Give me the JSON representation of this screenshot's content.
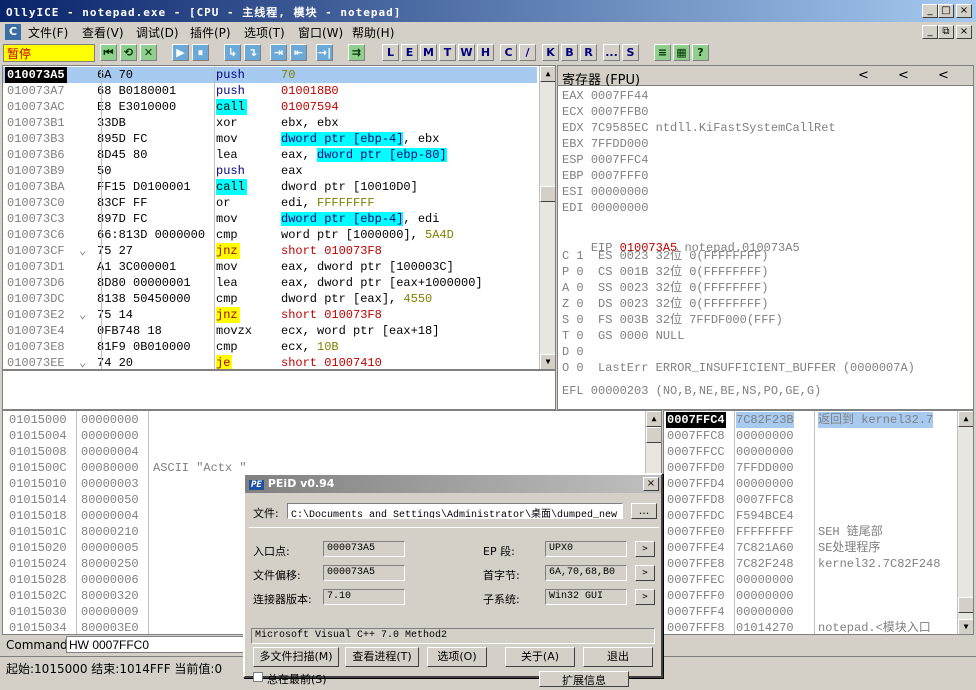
{
  "window": {
    "title": "OllyICE - notepad.exe - [CPU -  主线程, 模块 - notepad]",
    "min": "_",
    "max": "□",
    "close": "×",
    "inner_min": "_",
    "inner_restore": "⧉",
    "inner_close": "×"
  },
  "menu": {
    "icon": "C",
    "items": [
      "文件(F)",
      "查看(V)",
      "调试(D)",
      "插件(P)",
      "选项(T)",
      "窗口(W)",
      "帮助(H)"
    ]
  },
  "toolbar": {
    "status": "暂停",
    "buttons_a": [
      "⏮",
      "⟲",
      "✕",
      "▶",
      "⏸",
      "↳",
      "↴",
      "⇥",
      "⇤",
      "→|",
      "⇉"
    ],
    "letters": [
      "L",
      "E",
      "M",
      "T",
      "W",
      "H",
      "C",
      "/",
      "K",
      "B",
      "R",
      "...",
      "S"
    ],
    "icons_b": [
      "≡",
      "▦",
      "?"
    ]
  },
  "disasm": {
    "rows": [
      {
        "addr": "010073A5",
        "mark": "",
        "hex": "6A 70",
        "mnem": "push",
        "ops": [
          {
            "t": "70",
            "c": "olive"
          }
        ]
      },
      {
        "addr": "010073A7",
        "mark": "",
        "hex": "68 B0180001",
        "mnem": "push",
        "ops": [
          {
            "t": "010018B0",
            "c": "red"
          }
        ]
      },
      {
        "addr": "010073AC",
        "mark": "",
        "hex": "E8 E3010000",
        "mnem": "call",
        "mhl": "call",
        "ops": [
          {
            "t": "01007594",
            "c": "red"
          }
        ]
      },
      {
        "addr": "010073B1",
        "mark": "",
        "hex": "33DB",
        "mnem": "xor",
        "ops": [
          {
            "t": "ebx, ebx",
            "c": ""
          }
        ]
      },
      {
        "addr": "010073B3",
        "mark": "",
        "hex": "895D FC",
        "mnem": "mov",
        "ops": [
          {
            "t": "dword ptr [ebp-4]",
            "c": "mem"
          },
          {
            "t": ", ebx",
            "c": ""
          }
        ]
      },
      {
        "addr": "010073B6",
        "mark": "",
        "hex": "8D45 80",
        "mnem": "lea",
        "ops": [
          {
            "t": "eax, ",
            "c": ""
          },
          {
            "t": "dword ptr [ebp-80]",
            "c": "mem"
          }
        ]
      },
      {
        "addr": "010073B9",
        "mark": "",
        "hex": "50",
        "mnem": "push",
        "ops": [
          {
            "t": "eax",
            "c": ""
          }
        ]
      },
      {
        "addr": "010073BA",
        "mark": "",
        "hex": "FF15 D0100001",
        "mnem": "call",
        "mhl": "call",
        "ops": [
          {
            "t": "dword ptr [10010D0]",
            "c": ""
          }
        ]
      },
      {
        "addr": "010073C0",
        "mark": "",
        "hex": "83CF FF",
        "mnem": "or",
        "ops": [
          {
            "t": "edi, ",
            "c": ""
          },
          {
            "t": "FFFFFFFF",
            "c": "olive"
          }
        ]
      },
      {
        "addr": "010073C3",
        "mark": "",
        "hex": "897D FC",
        "mnem": "mov",
        "ops": [
          {
            "t": "dword ptr [ebp-4]",
            "c": "mem"
          },
          {
            "t": ", edi",
            "c": ""
          }
        ]
      },
      {
        "addr": "010073C6",
        "mark": "",
        "hex": "66:813D 0000000",
        "mnem": "cmp",
        "ops": [
          {
            "t": "word ptr [1000000], ",
            "c": ""
          },
          {
            "t": "5A4D",
            "c": "olive"
          }
        ]
      },
      {
        "addr": "010073CF",
        "mark": "⌄",
        "hex": "75 27",
        "mnem": "jnz",
        "mhl": "jmp",
        "ops": [
          {
            "t": "short 010073F8",
            "c": "red"
          }
        ]
      },
      {
        "addr": "010073D1",
        "mark": "",
        "hex": "A1 3C000001",
        "mnem": "mov",
        "ops": [
          {
            "t": "eax, dword ptr [100003C]",
            "c": ""
          }
        ]
      },
      {
        "addr": "010073D6",
        "mark": "",
        "hex": "8D80 00000001",
        "mnem": "lea",
        "ops": [
          {
            "t": "eax, dword ptr [eax+1000000]",
            "c": ""
          }
        ]
      },
      {
        "addr": "010073DC",
        "mark": "",
        "hex": "8138 50450000",
        "mnem": "cmp",
        "ops": [
          {
            "t": "dword ptr [eax], ",
            "c": ""
          },
          {
            "t": "4550",
            "c": "olive"
          }
        ]
      },
      {
        "addr": "010073E2",
        "mark": "⌄",
        "hex": "75 14",
        "mnem": "jnz",
        "mhl": "jmp",
        "ops": [
          {
            "t": "short 010073F8",
            "c": "red"
          }
        ]
      },
      {
        "addr": "010073E4",
        "mark": "",
        "hex": "0FB748 18",
        "mnem": "movzx",
        "ops": [
          {
            "t": "ecx, word ptr [eax+18]",
            "c": ""
          }
        ]
      },
      {
        "addr": "010073E8",
        "mark": "",
        "hex": "81F9 0B010000",
        "mnem": "cmp",
        "ops": [
          {
            "t": "ecx, ",
            "c": ""
          },
          {
            "t": "10B",
            "c": "olive"
          }
        ]
      },
      {
        "addr": "010073EE",
        "mark": "⌄",
        "hex": "74 20",
        "mnem": "je",
        "mhl": "jmp",
        "ops": [
          {
            "t": "short 01007410",
            "c": "red"
          }
        ]
      }
    ]
  },
  "registers": {
    "header": "寄存器 (FPU)",
    "arrows": [
      "<",
      "<",
      "<"
    ],
    "gp": [
      {
        "name": "EAX",
        "val": "0007FF44",
        "info": ""
      },
      {
        "name": "ECX",
        "val": "0007FFB0",
        "info": ""
      },
      {
        "name": "EDX",
        "val": "7C9585EC",
        "info": "ntdll.KiFastSystemCallRet"
      },
      {
        "name": "EBX",
        "val": "7FFDD000",
        "info": ""
      },
      {
        "name": "ESP",
        "val": "0007FFC4",
        "info": ""
      },
      {
        "name": "EBP",
        "val": "0007FFF0",
        "info": ""
      },
      {
        "name": "ESI",
        "val": "00000000",
        "info": ""
      },
      {
        "name": "EDI",
        "val": "00000000",
        "info": ""
      }
    ],
    "eip": {
      "name": "EIP",
      "val": "010073A5",
      "info": "notepad.010073A5"
    },
    "flags": [
      "C 1  ES 0023 32位 0(FFFFFFFF)",
      "P 0  CS 001B 32位 0(FFFFFFFF)",
      "A 0  SS 0023 32位 0(FFFFFFFF)",
      "Z 0  DS 0023 32位 0(FFFFFFFF)",
      "S 0  FS 003B 32位 7FFDF000(FFF)",
      "T 0  GS 0000 NULL",
      "D 0",
      "O 0  LastErr ERROR_INSUFFICIENT_BUFFER (0000007A)"
    ],
    "efl": "EFL 00000203 (NO,B,NE,BE,NS,PO,GE,G)"
  },
  "dump": {
    "rows": [
      {
        "addr": "01015000",
        "val": "00000000",
        "ascii": ""
      },
      {
        "addr": "01015004",
        "val": "00000000",
        "ascii": ""
      },
      {
        "addr": "01015008",
        "val": "00000004",
        "ascii": ""
      },
      {
        "addr": "0101500C",
        "val": "00080000",
        "ascii": "ASCII \"Actx \""
      },
      {
        "addr": "01015010",
        "val": "00000003",
        "ascii": ""
      },
      {
        "addr": "01015014",
        "val": "80000050",
        "ascii": ""
      },
      {
        "addr": "01015018",
        "val": "00000004",
        "ascii": ""
      },
      {
        "addr": "0101501C",
        "val": "80000210",
        "ascii": ""
      },
      {
        "addr": "01015020",
        "val": "00000005",
        "ascii": ""
      },
      {
        "addr": "01015024",
        "val": "80000250",
        "ascii": ""
      },
      {
        "addr": "01015028",
        "val": "00000006",
        "ascii": ""
      },
      {
        "addr": "0101502C",
        "val": "80000320",
        "ascii": ""
      },
      {
        "addr": "01015030",
        "val": "00000009",
        "ascii": ""
      },
      {
        "addr": "01015034",
        "val": "800003E0",
        "ascii": ""
      }
    ]
  },
  "stack": {
    "rows": [
      {
        "addr": "0007FFC4",
        "val": "7C82F23B",
        "info": "返回到 kernel32.7"
      },
      {
        "addr": "0007FFC8",
        "val": "00000000",
        "info": ""
      },
      {
        "addr": "0007FFCC",
        "val": "00000000",
        "info": ""
      },
      {
        "addr": "0007FFD0",
        "val": "7FFDD000",
        "info": ""
      },
      {
        "addr": "0007FFD4",
        "val": "00000000",
        "info": ""
      },
      {
        "addr": "0007FFD8",
        "val": "0007FFC8",
        "info": ""
      },
      {
        "addr": "0007FFDC",
        "val": "F594BCE4",
        "info": ""
      },
      {
        "addr": "0007FFE0",
        "val": "FFFFFFFF",
        "info": "SEH 链尾部"
      },
      {
        "addr": "0007FFE4",
        "val": "7C821A60",
        "info": "SE处理程序"
      },
      {
        "addr": "0007FFE8",
        "val": "7C82F248",
        "info": "kernel32.7C82F248"
      },
      {
        "addr": "0007FFEC",
        "val": "00000000",
        "info": ""
      },
      {
        "addr": "0007FFF0",
        "val": "00000000",
        "info": ""
      },
      {
        "addr": "0007FFF4",
        "val": "00000000",
        "info": ""
      },
      {
        "addr": "0007FFF8",
        "val": "01014270",
        "info": "notepad.<模块入口"
      }
    ]
  },
  "command": {
    "label": "Command",
    "value": "HW 0007FFC0"
  },
  "statusbar": {
    "text": "起始:1015000 结束:1014FFF 当前值:0"
  },
  "peid": {
    "title": "PEiD v0.94",
    "logo": "PE",
    "close": "×",
    "file_label": "文件:",
    "file_value": "C:\\Documents and Settings\\Administrator\\桌面\\dumped_new",
    "browse": "...",
    "entry_label": "入口点:",
    "entry_value": "000073A5",
    "ep_seg_label": "EP 段:",
    "ep_seg_value": "UPX0",
    "offset_label": "文件偏移:",
    "offset_value": "000073A5",
    "first_bytes_label": "首字节:",
    "first_bytes_value": "6A,70,68,B0",
    "linker_label": "连接器版本:",
    "linker_value": "7.10",
    "subsystem_label": "子系统:",
    "subsystem_value": "Win32 GUI",
    "arrow": ">",
    "detected": "Microsoft Visual C++ 7.0 Method2",
    "buttons": [
      "多文件扫描(M)",
      "查看进程(T)",
      "选项(O)",
      "关于(A)",
      "退出"
    ],
    "partial_checkbox": "总在最前(S)",
    "partial_button": "扩展信息"
  }
}
